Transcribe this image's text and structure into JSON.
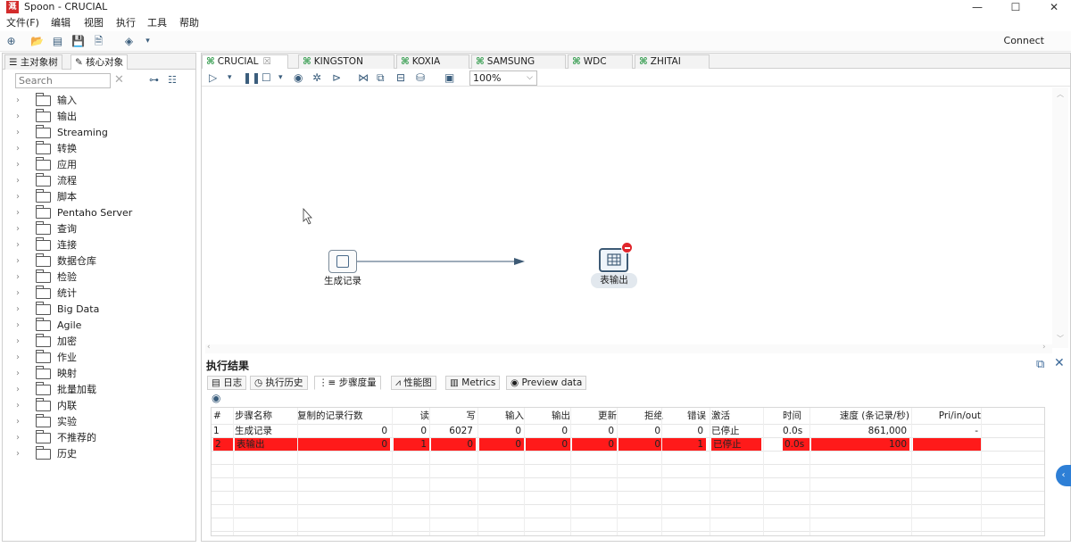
{
  "window": {
    "title": "Spoon - CRUCIAL",
    "app_icon": "溉",
    "minimize": "—",
    "maximize": "☐",
    "close": "✕"
  },
  "menu": [
    "文件(F)",
    "编辑",
    "视图",
    "执行",
    "工具",
    "帮助"
  ],
  "toolbar": {
    "connect": "Connect"
  },
  "left": {
    "tabs": [
      "主对象树",
      "核心对象"
    ],
    "search_placeholder": "Search",
    "tree": [
      "输入",
      "输出",
      "Streaming",
      "转换",
      "应用",
      "流程",
      "脚本",
      "Pentaho Server",
      "查询",
      "连接",
      "数据仓库",
      "检验",
      "统计",
      "Big Data",
      "Agile",
      "加密",
      "作业",
      "映射",
      "批量加载",
      "内联",
      "实验",
      "不推荐的",
      "历史"
    ]
  },
  "file_tabs": [
    "CRUCIAL",
    "KINGSTON",
    "KOXIA",
    "SAMSUNG",
    "WDC",
    "ZHITAI"
  ],
  "zoom": "100%",
  "canvas": {
    "steps": [
      {
        "label": "生成记录",
        "icon": "generate-rows-icon"
      },
      {
        "label": "表输出",
        "icon": "table-output-icon"
      }
    ]
  },
  "results": {
    "title": "执行结果",
    "tabs": [
      "日志",
      "执行历史",
      "步骤度量",
      "性能图",
      "Metrics",
      "Preview data"
    ],
    "columns": [
      "#",
      "步骤名称",
      "复制的记录行数",
      "读",
      "写",
      "输入",
      "输出",
      "更新",
      "拒绝",
      "错误",
      "激活",
      "时间",
      "速度 (条记录/秒)",
      "Pri/in/out"
    ],
    "rows": [
      [
        "1",
        "生成记录",
        "0",
        "0",
        "6027",
        "0",
        "0",
        "0",
        "0",
        "0",
        "已停止",
        "0.0s",
        "861,000",
        "-"
      ],
      [
        "2",
        "表输出",
        "0",
        "1",
        "0",
        "0",
        "0",
        "0",
        "0",
        "1",
        "已停止",
        "0.0s",
        "100",
        ""
      ]
    ],
    "error_color": "#ff1a1a"
  }
}
